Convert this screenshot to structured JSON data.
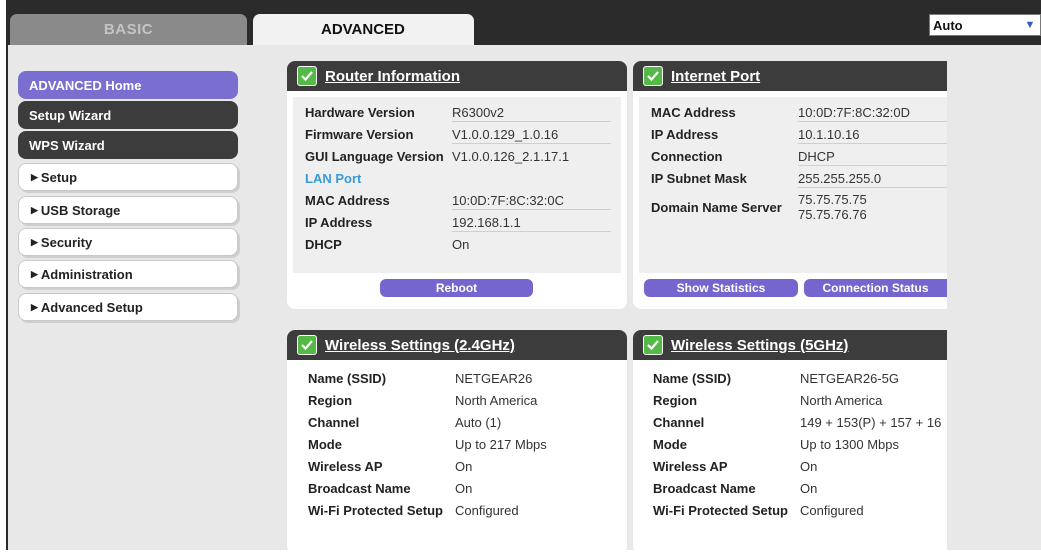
{
  "tabs": {
    "basic": "BASIC",
    "advanced": "ADVANCED"
  },
  "language_select": {
    "value": "Auto"
  },
  "sidebar": {
    "items": [
      {
        "label": "ADVANCED Home"
      },
      {
        "label": "Setup Wizard"
      },
      {
        "label": "WPS Wizard"
      },
      {
        "label": "Setup"
      },
      {
        "label": "USB Storage"
      },
      {
        "label": "Security"
      },
      {
        "label": "Administration"
      },
      {
        "label": "Advanced Setup"
      }
    ]
  },
  "router_info": {
    "title": "Router Information",
    "hardware_version": {
      "label": "Hardware Version",
      "value": "R6300v2"
    },
    "firmware_version": {
      "label": "Firmware Version",
      "value": "V1.0.0.129_1.0.16"
    },
    "gui_language_version": {
      "label": "GUI Language Version",
      "value": "V1.0.0.126_2.1.17.1"
    },
    "lan_port_label": "LAN Port",
    "mac_address": {
      "label": "MAC Address",
      "value": "10:0D:7F:8C:32:0C"
    },
    "ip_address": {
      "label": "IP Address",
      "value": "192.168.1.1"
    },
    "dhcp": {
      "label": "DHCP",
      "value": "On"
    },
    "reboot_button": "Reboot"
  },
  "internet_port": {
    "title": "Internet Port",
    "mac_address": {
      "label": "MAC Address",
      "value": "10:0D:7F:8C:32:0D"
    },
    "ip_address": {
      "label": "IP Address",
      "value": "10.1.10.16"
    },
    "connection": {
      "label": "Connection",
      "value": "DHCP"
    },
    "ip_subnet_mask": {
      "label": "IP Subnet Mask",
      "value": "255.255.255.0"
    },
    "dns": {
      "label": "Domain Name Server",
      "value1": "75.75.75.75",
      "value2": "75.75.76.76"
    },
    "show_statistics_button": "Show Statistics",
    "connection_status_button": "Connection Status"
  },
  "wireless_24": {
    "title": "Wireless Settings (2.4GHz)",
    "rows": [
      {
        "label": "Name (SSID)",
        "value": "NETGEAR26"
      },
      {
        "label": "Region",
        "value": "North America"
      },
      {
        "label": "Channel",
        "value": "Auto (1)"
      },
      {
        "label": "Mode",
        "value": "Up to 217 Mbps"
      },
      {
        "label": "Wireless AP",
        "value": "On"
      },
      {
        "label": "Broadcast Name",
        "value": "On"
      },
      {
        "label": "Wi-Fi Protected Setup",
        "value": "Configured"
      }
    ]
  },
  "wireless_5": {
    "title": "Wireless Settings (5GHz)",
    "rows": [
      {
        "label": "Name (SSID)",
        "value": "NETGEAR26-5G"
      },
      {
        "label": "Region",
        "value": "North America"
      },
      {
        "label": "Channel",
        "value": "149 + 153(P) + 157 + 16"
      },
      {
        "label": "Mode",
        "value": "Up to 1300 Mbps"
      },
      {
        "label": "Wireless AP",
        "value": "On"
      },
      {
        "label": "Broadcast Name",
        "value": "On"
      },
      {
        "label": "Wi-Fi Protected Setup",
        "value": "Configured"
      }
    ]
  }
}
